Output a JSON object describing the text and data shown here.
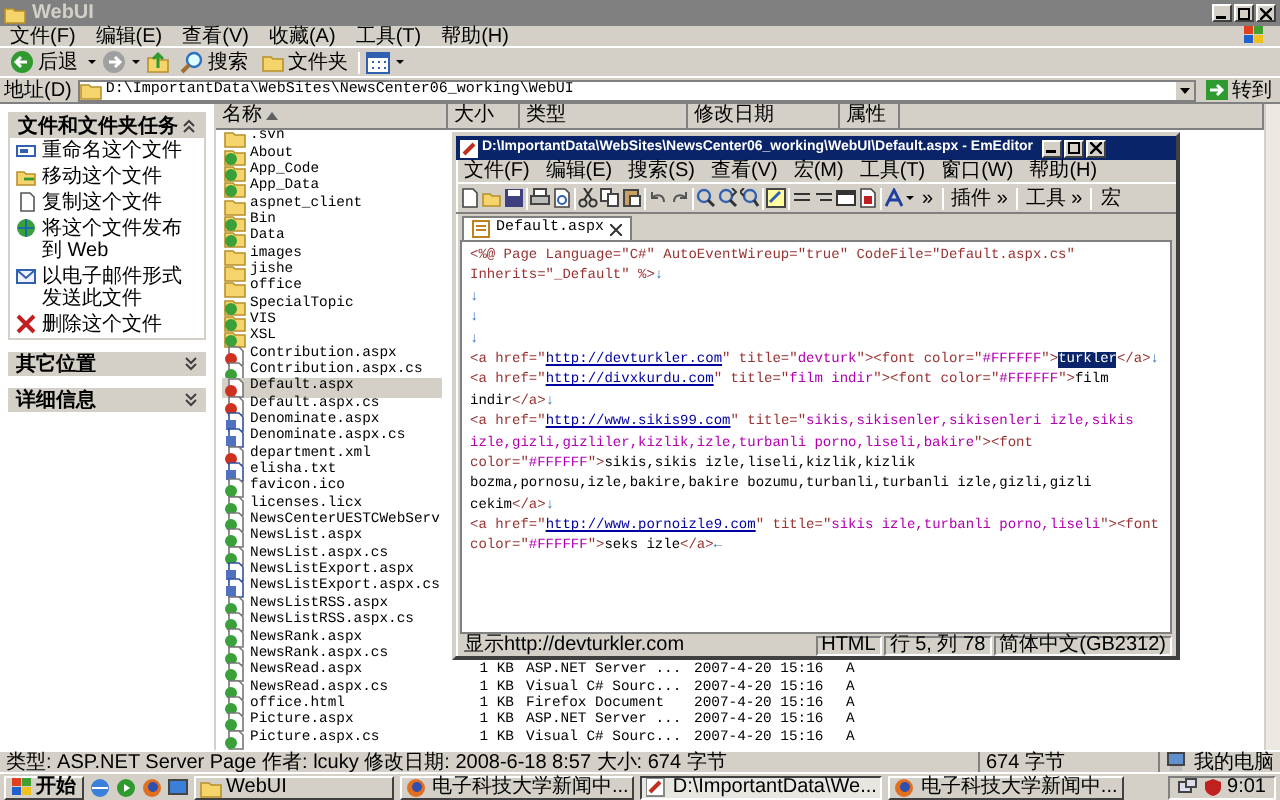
{
  "window": {
    "title": "WebUI"
  },
  "menu": [
    "文件(F)",
    "编辑(E)",
    "查看(V)",
    "收藏(A)",
    "工具(T)",
    "帮助(H)"
  ],
  "toolbar": {
    "back": "后退",
    "search": "搜索",
    "folders": "文件夹"
  },
  "address": {
    "label": "地址(D)",
    "value": "D:\\ImportantData\\WebSites\\NewsCenter06_working\\WebUI",
    "go": "转到"
  },
  "tasks": {
    "title": "文件和文件夹任务",
    "items": [
      {
        "label": "重命名这个文件",
        "kind": "rename"
      },
      {
        "label": "移动这个文件",
        "kind": "move"
      },
      {
        "label": "复制这个文件",
        "kind": "copy"
      },
      {
        "label": "将这个文件发布到 Web",
        "kind": "publish"
      },
      {
        "label": "以电子邮件形式发送此文件",
        "kind": "email"
      },
      {
        "label": "删除这个文件",
        "kind": "delete"
      }
    ]
  },
  "panels": [
    "其它位置",
    "详细信息"
  ],
  "file_list": {
    "columns": [
      "名称",
      "大小",
      "类型",
      "修改日期",
      "属性"
    ],
    "rows": [
      {
        "name": ".svn",
        "kind": "folder",
        "selected": false
      },
      {
        "name": "About",
        "kind": "webfolder",
        "selected": false
      },
      {
        "name": "App_Code",
        "kind": "webfolder",
        "selected": false
      },
      {
        "name": "App_Data",
        "kind": "webfolder",
        "selected": false
      },
      {
        "name": "aspnet_client",
        "kind": "folder",
        "selected": false
      },
      {
        "name": "Bin",
        "kind": "webfolder",
        "selected": false
      },
      {
        "name": "Data",
        "kind": "webfolder",
        "selected": false
      },
      {
        "name": "images",
        "kind": "folder",
        "selected": false
      },
      {
        "name": "jishe",
        "kind": "folder",
        "selected": false
      },
      {
        "name": "office",
        "kind": "folder",
        "selected": false
      },
      {
        "name": "SpecialTopic",
        "kind": "webfolder",
        "selected": false
      },
      {
        "name": "VIS",
        "kind": "webfolder",
        "selected": false
      },
      {
        "name": "XSL",
        "kind": "webfolder",
        "selected": false
      },
      {
        "name": "Contribution.aspx",
        "kind": "aspx",
        "selected": false
      },
      {
        "name": "Contribution.aspx.cs",
        "kind": "cs",
        "selected": false
      },
      {
        "name": "Default.aspx",
        "kind": "aspx",
        "selected": true
      },
      {
        "name": "Default.aspx.cs",
        "kind": "aspx",
        "selected": false
      },
      {
        "name": "Denominate.aspx",
        "kind": "page",
        "selected": false
      },
      {
        "name": "Denominate.aspx.cs",
        "kind": "page",
        "selected": false
      },
      {
        "name": "department.xml",
        "kind": "aspx",
        "selected": false
      },
      {
        "name": "elisha.txt",
        "kind": "page",
        "selected": false
      },
      {
        "name": "favicon.ico",
        "kind": "cs",
        "selected": false
      },
      {
        "name": "licenses.licx",
        "kind": "cs",
        "selected": false
      },
      {
        "name": "NewsCenterUESTCWebServ",
        "kind": "cs",
        "selected": false
      },
      {
        "name": "NewsList.aspx",
        "kind": "cs",
        "selected": false
      },
      {
        "name": "NewsList.aspx.cs",
        "kind": "cs",
        "selected": false
      },
      {
        "name": "NewsListExport.aspx",
        "kind": "page",
        "selected": false
      },
      {
        "name": "NewsListExport.aspx.cs",
        "kind": "page",
        "selected": false
      },
      {
        "name": "NewsListRSS.aspx",
        "kind": "cs",
        "selected": false
      },
      {
        "name": "NewsListRSS.aspx.cs",
        "kind": "cs",
        "selected": false
      },
      {
        "name": "NewsRank.aspx",
        "kind": "cs",
        "selected": false
      },
      {
        "name": "NewsRank.aspx.cs",
        "kind": "cs",
        "selected": false
      },
      {
        "name": "NewsRead.aspx",
        "kind": "cs",
        "selected": false,
        "size": "1 KB",
        "type": "ASP.NET Server ...",
        "modified": "2007-4-20 15:16",
        "attributes": "A"
      },
      {
        "name": "NewsRead.aspx.cs",
        "kind": "cs",
        "selected": false,
        "size": "1 KB",
        "type": "Visual C# Sourc...",
        "modified": "2007-4-20 15:16",
        "attributes": "A"
      },
      {
        "name": "office.html",
        "kind": "cs",
        "selected": false,
        "size": "1 KB",
        "type": "Firefox Document",
        "modified": "2007-4-20 15:16",
        "attributes": "A"
      },
      {
        "name": "Picture.aspx",
        "kind": "cs",
        "selected": false,
        "size": "1 KB",
        "type": "ASP.NET Server ...",
        "modified": "2007-4-20 15:16",
        "attributes": "A"
      },
      {
        "name": "Picture.aspx.cs",
        "kind": "cs",
        "selected": false,
        "size": "1 KB",
        "type": "Visual C# Sourc...",
        "modified": "2007-4-20 15:16",
        "attributes": "A"
      }
    ]
  },
  "editor": {
    "title": "D:\\ImportantData\\WebSites\\NewsCenter06_working\\WebUI\\Default.aspx - EmEditor",
    "menu": [
      "文件(F)",
      "编辑(E)",
      "搜索(S)",
      "查看(V)",
      "宏(M)",
      "工具(T)",
      "窗口(W)",
      "帮助(H)"
    ],
    "toolbar_labels": [
      "»",
      "插件 »",
      "工具 »",
      "宏"
    ],
    "tab": "Default.aspx",
    "lines": [
      [
        {
          "kind": "tag",
          "text": "<%@ Page Language=\"C#\" AutoEventWireup=\"true\" CodeFile=\"Default.aspx.cs\""
        }
      ],
      [
        {
          "kind": "tag",
          "text": "Inherits=\"_Default\" %>"
        },
        {
          "kind": "mark",
          "text": "↓"
        }
      ],
      [
        {
          "kind": "mark",
          "text": "↓"
        }
      ],
      [
        {
          "kind": "mark",
          "text": "↓"
        }
      ],
      [
        {
          "kind": "mark",
          "text": "↓"
        }
      ],
      [
        {
          "kind": "tag",
          "text": "<a href=\""
        },
        {
          "kind": "url",
          "text": "http://devturkler.com"
        },
        {
          "kind": "tag",
          "text": "\" title=\""
        },
        {
          "kind": "string",
          "text": "devturk"
        },
        {
          "kind": "tag",
          "text": "\"><font color=\""
        },
        {
          "kind": "string",
          "text": "#FFFFFF"
        },
        {
          "kind": "tag",
          "text": "\">"
        },
        {
          "kind": "selected",
          "text": "turkler"
        },
        {
          "kind": "tag",
          "text": "</a>"
        },
        {
          "kind": "mark",
          "text": "↓"
        }
      ],
      [
        {
          "kind": "tag",
          "text": "<a href=\""
        },
        {
          "kind": "url",
          "text": "http://divxkurdu.com"
        },
        {
          "kind": "tag",
          "text": "\" title=\""
        },
        {
          "kind": "string",
          "text": "film indir"
        },
        {
          "kind": "tag",
          "text": "\"><font color=\""
        },
        {
          "kind": "string",
          "text": "#FFFFFF"
        },
        {
          "kind": "tag",
          "text": "\">"
        },
        {
          "kind": "text",
          "text": "film"
        }
      ],
      [
        {
          "kind": "text",
          "text": "indir"
        },
        {
          "kind": "tag",
          "text": "</a>"
        },
        {
          "kind": "mark",
          "text": "↓"
        }
      ],
      [
        {
          "kind": "tag",
          "text": "<a href=\""
        },
        {
          "kind": "url",
          "text": "http://www.sikis99.com"
        },
        {
          "kind": "tag",
          "text": "\" title=\""
        },
        {
          "kind": "string",
          "text": "sikis,sikisenler,sikisenleri izle,sikis"
        }
      ],
      [
        {
          "kind": "string",
          "text": "izle,gizli,gizliler,kizlik,izle,turbanli porno,liseli,bakire"
        },
        {
          "kind": "tag",
          "text": "\"><font"
        }
      ],
      [
        {
          "kind": "tag",
          "text": "color=\""
        },
        {
          "kind": "string",
          "text": "#FFFFFF"
        },
        {
          "kind": "tag",
          "text": "\">"
        },
        {
          "kind": "text",
          "text": "sikis,sikis izle,liseli,kizlik,kizlik"
        }
      ],
      [
        {
          "kind": "text",
          "text": "bozma,pornosu,izle,bakire,bakire bozumu,turbanli,turbanli izle,gizli,gizli"
        }
      ],
      [
        {
          "kind": "text",
          "text": "cekim"
        },
        {
          "kind": "tag",
          "text": "</a>"
        },
        {
          "kind": "mark",
          "text": "↓"
        }
      ],
      [
        {
          "kind": "tag",
          "text": "<a href=\""
        },
        {
          "kind": "url",
          "text": "http://www.pornoizle9.com"
        },
        {
          "kind": "tag",
          "text": "\" title=\""
        },
        {
          "kind": "string",
          "text": "sikis izle,turbanli porno,liseli"
        },
        {
          "kind": "tag",
          "text": "\"><font"
        }
      ],
      [
        {
          "kind": "tag",
          "text": "color=\""
        },
        {
          "kind": "string",
          "text": "#FFFFFF"
        },
        {
          "kind": "tag",
          "text": "\">"
        },
        {
          "kind": "text",
          "text": "seks izle"
        },
        {
          "kind": "tag",
          "text": "</a>"
        },
        {
          "kind": "mark",
          "text": "←"
        }
      ]
    ],
    "status": {
      "hint": "显示http://devturkler.com",
      "mode": "HTML",
      "position": "行 5, 列 78",
      "encoding": "简体中文(GB2312)"
    }
  },
  "status_bar": {
    "info": "类型: ASP.NET Server Page 作者: lcuky 修改日期: 2008-6-18 8:57 大小: 674 字节",
    "size": "674 字节",
    "zone": "我的电脑"
  },
  "taskbar": {
    "start": "开始",
    "tasks": [
      {
        "label": "WebUI",
        "kind": "folder",
        "selected": false
      },
      {
        "label": "电子科技大学新闻中...",
        "kind": "browser",
        "selected": false
      },
      {
        "label": "D:\\ImportantData\\We...",
        "kind": "editor",
        "selected": true
      },
      {
        "label": "电子科技大学新闻中...",
        "kind": "browser",
        "selected": false
      }
    ],
    "clock": "9:01"
  }
}
